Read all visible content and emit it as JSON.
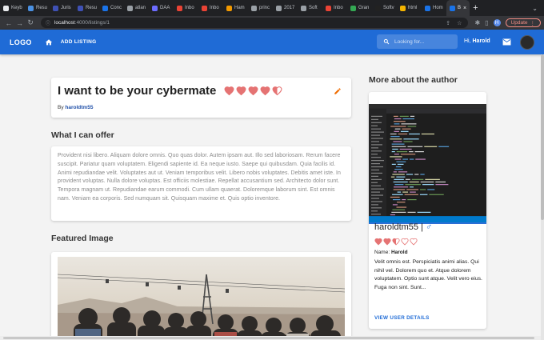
{
  "browser": {
    "tabs": [
      {
        "label": "Keyb",
        "color": "#e8eaed"
      },
      {
        "label": "Resu",
        "color": "#4a90e2"
      },
      {
        "label": "Juris",
        "color": "#3f51b5"
      },
      {
        "label": "Resu",
        "color": "#3f51b5"
      },
      {
        "label": "Conc",
        "color": "#1a73e8"
      },
      {
        "label": "atlan",
        "color": "#9aa0a6"
      },
      {
        "label": "DAA",
        "color": "#6c6cff"
      },
      {
        "label": "Inbo",
        "color": "#ea4335"
      },
      {
        "label": "Inbo",
        "color": "#ea4335"
      },
      {
        "label": "Ham",
        "color": "#f29900"
      },
      {
        "label": "princ",
        "color": "#9aa0a6"
      },
      {
        "label": "2017",
        "color": "#9aa0a6"
      },
      {
        "label": "Soft",
        "color": "#9aa0a6"
      },
      {
        "label": "Inbo",
        "color": "#ea4335"
      },
      {
        "label": "Gran",
        "color": "#34a853"
      },
      {
        "label": "Softv",
        "color": "#222222"
      },
      {
        "label": "html",
        "color": "#f4b400"
      },
      {
        "label": "Hom",
        "color": "#1a73e8"
      }
    ],
    "active_tab": {
      "label": "B",
      "color": "#1a73e8"
    },
    "url_host": "localhost",
    "url_path": ":4000/listings/1",
    "update_label": "Update"
  },
  "nav": {
    "logo": "LOGO",
    "add_listing": "ADD LISTING",
    "search_placeholder": "Looking for...",
    "greeting": "Hi, ",
    "username": "Harold"
  },
  "listing": {
    "title": "I want to be your cybermate",
    "rating": 4.5,
    "by_label": "By ",
    "author": "haroldtm55",
    "offer_heading": "What I can offer",
    "offer_text": "Provident nisi libero. Aliquam dolore omnis. Quo quas dolor. Autem ipsam aut. Illo sed laboriosam. Rerum facere suscipit. Pariatur quam voluptatem. Eligendi sapiente id. Ea neque iusto. Saepe qui quibusdam. Quia facilis id. Animi repudiandae velit. Voluptates aut ut. Veniam temporibus velit. Libero nobis voluptates. Debitis amet iste. In provident voluptas. Nulla dolore voluptas. Est officiis molestiae. Repellat accusantium sed. Architecto dolor sunt. Tempora magnam ut. Repudiandae earum commodi. Cum ullam quaerat. Doloremque laborum sint. Est omnis nam. Veniam ea corporis. Sed numquam sit. Quisquam maxime et. Quis optio inventore.",
    "image_heading": "Featured Image"
  },
  "author_panel": {
    "heading": "More about the author",
    "username": "haroldtm55",
    "separator": " | ",
    "gender_symbol": "♂",
    "rating": 2.5,
    "name_label": "Name: ",
    "name": "Harold",
    "bio": "Velit omnis est. Perspiciatis animi alias. Qui nihil vel. Dolorem quo et. Atque dolorem voluptatem. Optio sunt atque. Velit vero eius. Fuga non sint. Sunt...",
    "view_details": "VIEW USER DETAILS"
  },
  "colors": {
    "app_bar": "#1f6bd6",
    "heart": "#e57373",
    "accent_link": "#1f4fa8",
    "edit_icon": "#ef6c00"
  }
}
